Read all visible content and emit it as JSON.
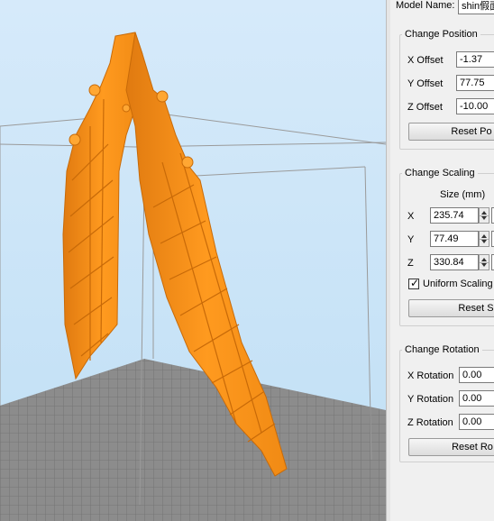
{
  "model": {
    "name_label": "Model Name:",
    "name_value": "shin假面"
  },
  "position": {
    "title": "Change Position",
    "x_label": "X Offset",
    "x_value": "-1.37",
    "y_label": "Y Offset",
    "y_value": "77.75",
    "z_label": "Z Offset",
    "z_value": "-10.00",
    "reset_label": "Reset Po"
  },
  "scaling": {
    "title": "Change Scaling",
    "size_header": "Size (mm)",
    "x_label": "X",
    "x_value": "235.74",
    "y_label": "Y",
    "y_value": "77.49",
    "z_label": "Z",
    "z_value": "330.84",
    "uniform_label": "Uniform Scaling",
    "uniform_checked": true,
    "reset_label": "Reset S"
  },
  "rotation": {
    "title": "Change Rotation",
    "x_label": "X Rotation",
    "x_value": "0.00",
    "y_label": "Y Rotation",
    "y_value": "0.00",
    "z_label": "Z Rotation",
    "z_value": "0.00",
    "reset_label": "Reset Ro"
  },
  "colors": {
    "model": "#ff9a1f",
    "bed": "#8a8a8a",
    "sky_top": "#d8ecfb",
    "sky_bottom": "#bcdcf4"
  }
}
